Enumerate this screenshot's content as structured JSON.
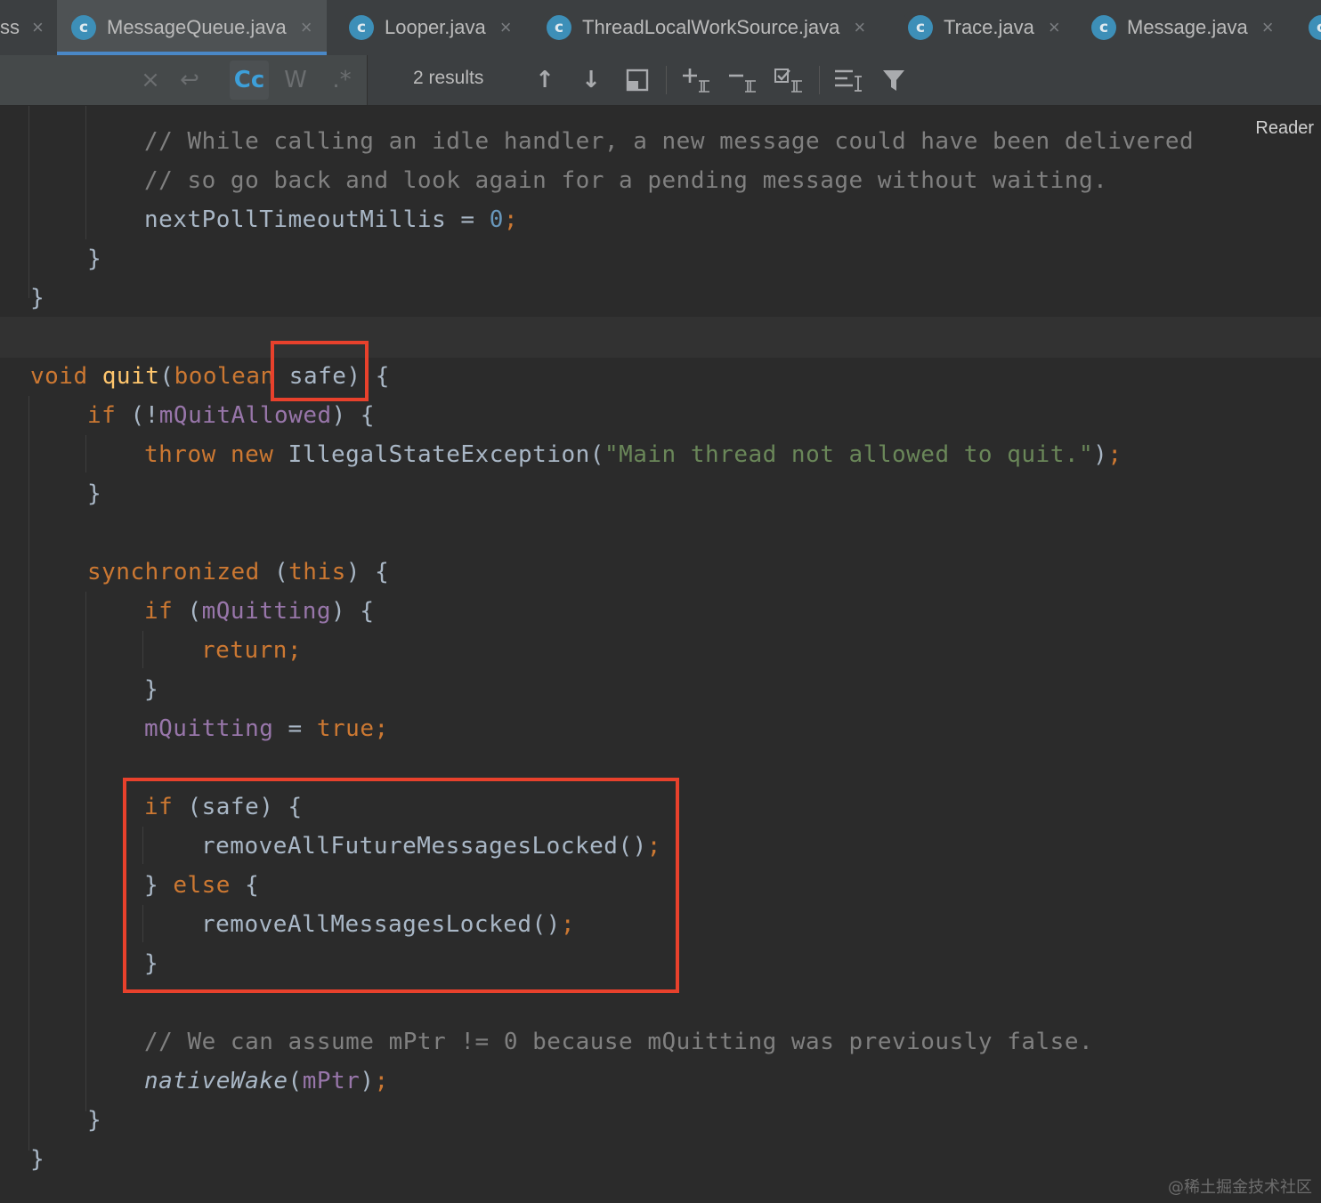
{
  "tabs": [
    {
      "label": "ss",
      "active": false
    },
    {
      "label": "MessageQueue.java",
      "active": true
    },
    {
      "label": "Looper.java",
      "active": false
    },
    {
      "label": "ThreadLocalWorkSource.java",
      "active": false
    },
    {
      "label": "Trace.java",
      "active": false
    },
    {
      "label": "Message.java",
      "active": false
    }
  ],
  "find_toolbar": {
    "clear_glyph": "×",
    "newline_glyph": "↩",
    "match_case_label": "Cc",
    "words_label": "W",
    "regex_label": ".*",
    "results_text": "2 results",
    "prev_glyph": "↑",
    "next_glyph": "↓"
  },
  "editor": {
    "reader_label": "Reader",
    "code": {
      "l1": "// While calling an idle handler, a new message could have been delivered",
      "l2": "// so go back and look again for a pending message without waiting.",
      "l3_var": "nextPollTimeoutMillis",
      "l3_eq": " = ",
      "l3_num": "0",
      "l3_semi": ";",
      "brace_close": "}",
      "brace_open": "{",
      "void_kw": "void",
      "quit_fn": "quit",
      "paren_open": "(",
      "boolean_kw": "boolean",
      "safe_param": "safe",
      "paren_close_brace": ") {",
      "if_kw": "if",
      "not_open": " (!",
      "mQuitAllowed": "mQuitAllowed",
      "throw_kw": "throw",
      "new_kw": "new",
      "exception_call": "IllegalStateException(",
      "exception_msg": "\"Main thread not allowed to quit.\"",
      "call_end": ")",
      "semi": ";",
      "synchronized_kw": "synchronized",
      "this_kw": "this",
      "mQuitting": "mQuitting",
      "return_kw": "return",
      "true_kw": "true",
      "safe_cond": "(safe) {",
      "remove_future": "removeAllFutureMessagesLocked()",
      "else_kw": "else",
      "remove_all": "removeAllMessagesLocked()",
      "comment_mptr": "// We can assume mPtr != 0 because mQuitting was previously false.",
      "nativeWake": "nativeWake",
      "mPtr": "mPtr"
    }
  },
  "watermark": "@稀土掘金技术社区",
  "colors": {
    "background": "#2b2b2b",
    "keyword": "#cc7832",
    "function": "#ffc66d",
    "field": "#9876aa",
    "number": "#6897bb",
    "string": "#6a8759",
    "comment": "#808080",
    "highlight_box": "#e8412c"
  }
}
